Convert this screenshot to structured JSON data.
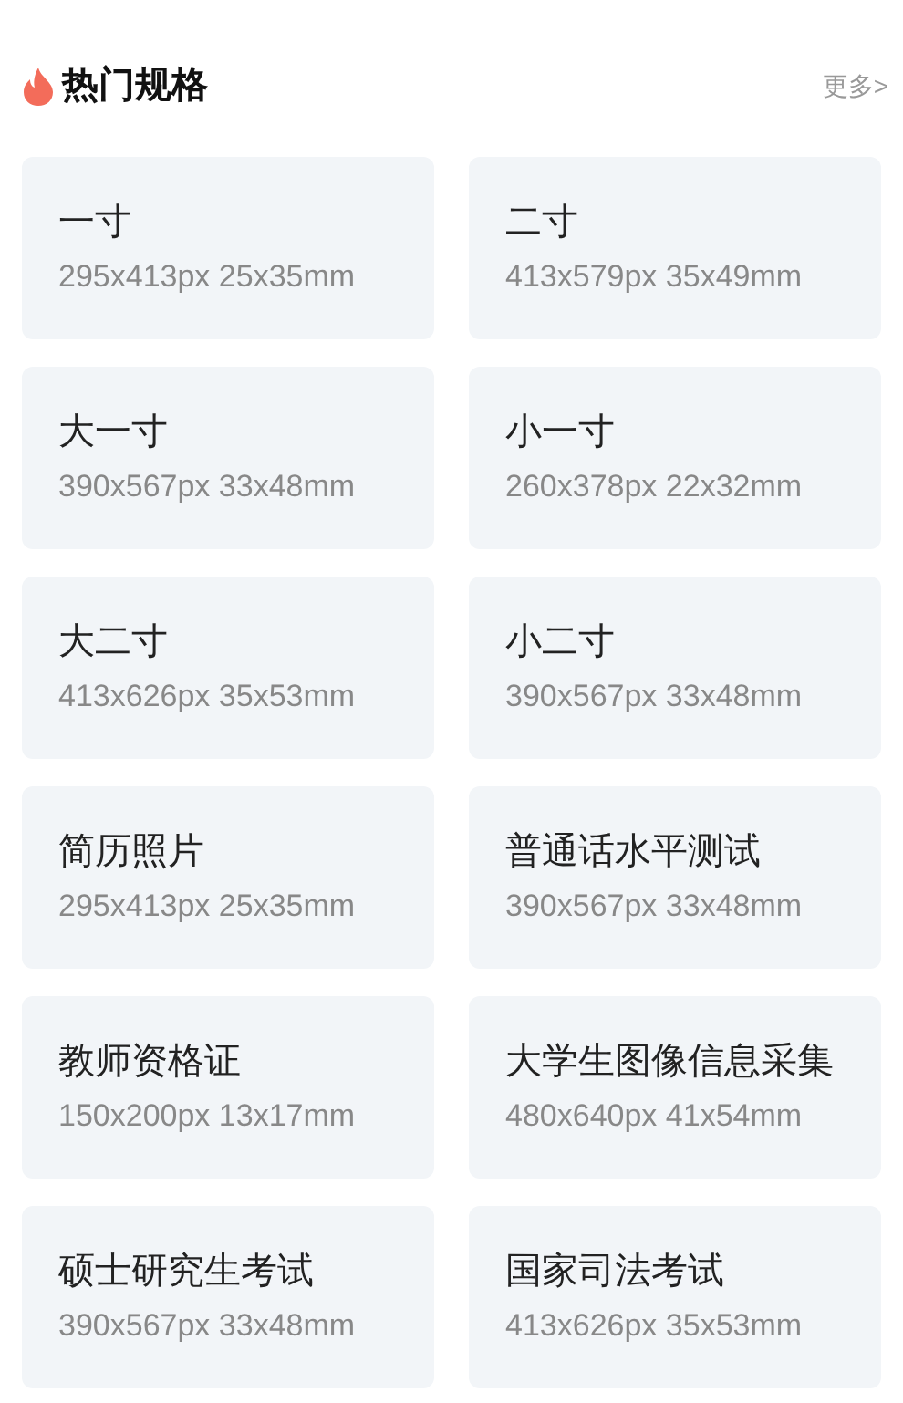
{
  "header": {
    "title": "热门规格",
    "more": "更多>"
  },
  "specs": [
    {
      "name": "一寸",
      "size": "295x413px 25x35mm"
    },
    {
      "name": "二寸",
      "size": "413x579px 35x49mm"
    },
    {
      "name": "大一寸",
      "size": "390x567px 33x48mm"
    },
    {
      "name": "小一寸",
      "size": "260x378px 22x32mm"
    },
    {
      "name": "大二寸",
      "size": "413x626px 35x53mm"
    },
    {
      "name": "小二寸",
      "size": "390x567px 33x48mm"
    },
    {
      "name": "简历照片",
      "size": "295x413px 25x35mm"
    },
    {
      "name": "普通话水平测试",
      "size": "390x567px 33x48mm"
    },
    {
      "name": "教师资格证",
      "size": "150x200px 13x17mm"
    },
    {
      "name": "大学生图像信息采集",
      "size": "480x640px 41x54mm"
    },
    {
      "name": "硕士研究生考试",
      "size": "390x567px 33x48mm"
    },
    {
      "name": "国家司法考试",
      "size": "413x626px 35x53mm"
    }
  ]
}
